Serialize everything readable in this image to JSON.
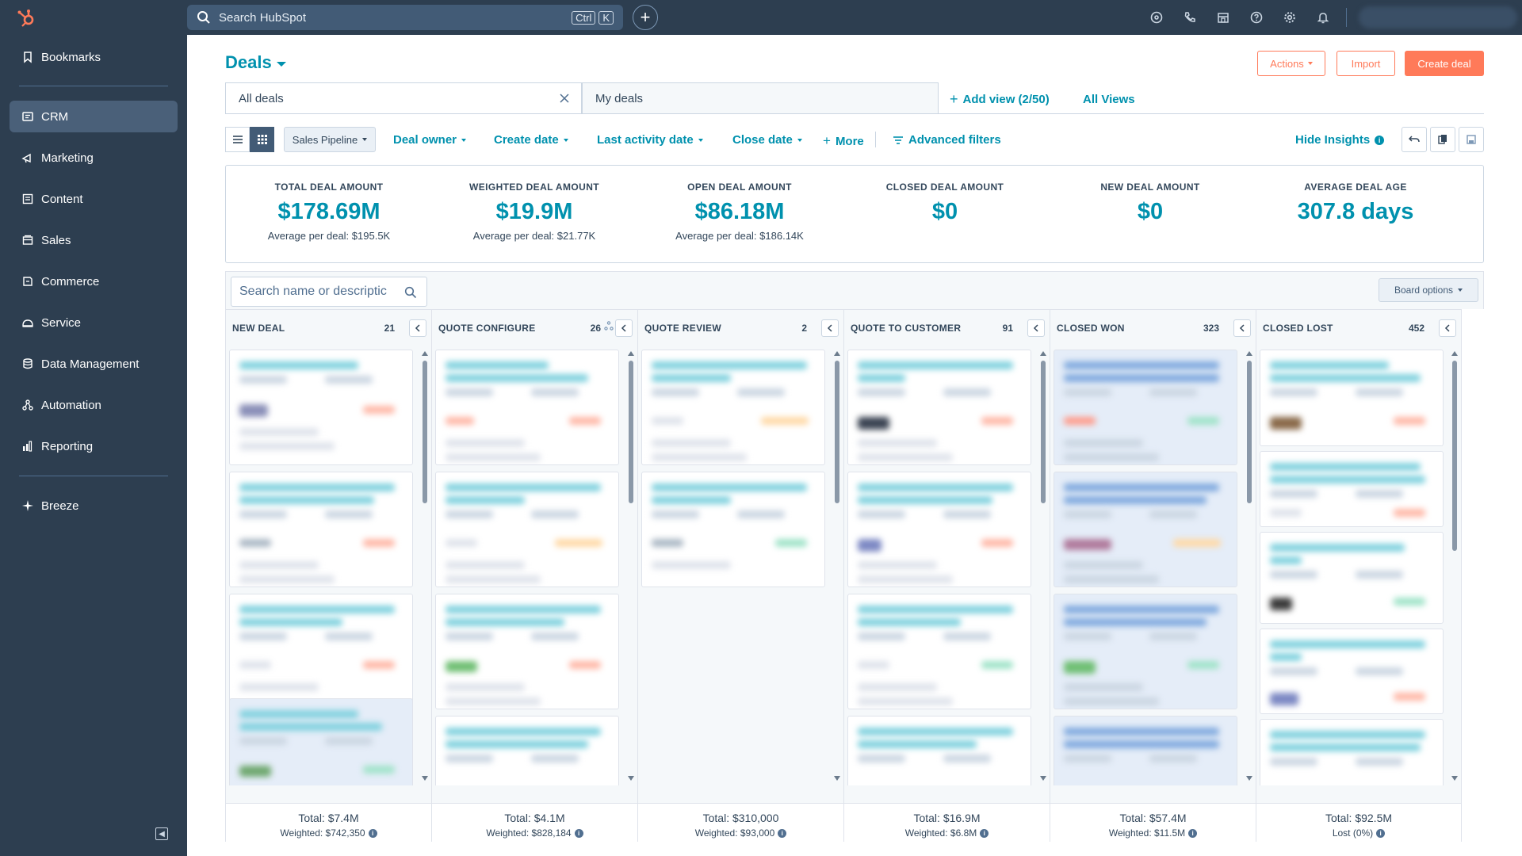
{
  "topbar": {
    "search_placeholder": "Search HubSpot",
    "shortcut_keys": [
      "Ctrl",
      "K"
    ],
    "icons": [
      "help-circle-icon",
      "phone-icon",
      "marketplace-icon",
      "question-icon",
      "settings-icon",
      "notifications-icon"
    ]
  },
  "sidebar": {
    "items": [
      {
        "label": "Bookmarks",
        "icon": "bookmark-icon"
      },
      {
        "label": "CRM",
        "icon": "crm-icon"
      },
      {
        "label": "Marketing",
        "icon": "marketing-icon"
      },
      {
        "label": "Content",
        "icon": "content-icon"
      },
      {
        "label": "Sales",
        "icon": "sales-icon"
      },
      {
        "label": "Commerce",
        "icon": "commerce-icon"
      },
      {
        "label": "Service",
        "icon": "service-icon"
      },
      {
        "label": "Data Management",
        "icon": "database-icon"
      },
      {
        "label": "Automation",
        "icon": "automation-icon"
      },
      {
        "label": "Reporting",
        "icon": "reporting-icon"
      },
      {
        "label": "Breeze",
        "icon": "breeze-icon"
      }
    ],
    "active": "CRM"
  },
  "header": {
    "title": "Deals",
    "actions_label": "Actions",
    "import_label": "Import",
    "create_label": "Create deal"
  },
  "views": {
    "tabs": [
      "All deals",
      "My deals"
    ],
    "add_view": "Add view (2/50)",
    "all_views": "All Views"
  },
  "filters": {
    "pipeline": "Sales Pipeline",
    "items": [
      "Deal owner",
      "Create date",
      "Last activity date",
      "Close date"
    ],
    "more": "More",
    "advanced": "Advanced filters",
    "hide_insights": "Hide Insights"
  },
  "insights": [
    {
      "label": "TOTAL DEAL AMOUNT",
      "value": "$178.69M",
      "sub": "Average per deal: $195.5K"
    },
    {
      "label": "WEIGHTED DEAL AMOUNT",
      "value": "$19.9M",
      "sub": "Average per deal: $21.77K"
    },
    {
      "label": "OPEN DEAL AMOUNT",
      "value": "$86.18M",
      "sub": "Average per deal: $186.14K"
    },
    {
      "label": "CLOSED DEAL AMOUNT",
      "value": "$0",
      "sub": ""
    },
    {
      "label": "NEW DEAL AMOUNT",
      "value": "$0",
      "sub": ""
    },
    {
      "label": "AVERAGE DEAL AGE",
      "value": "307.8 days",
      "sub": ""
    }
  ],
  "board": {
    "search_placeholder": "Search name or descriptic",
    "options_label": "Board options",
    "columns": [
      {
        "name": "NEW DEAL",
        "count": "21",
        "total": "Total: $7.4M",
        "weighted": "Weighted: $742,350"
      },
      {
        "name": "QUOTE CONFIGURE",
        "count": "26",
        "total": "Total: $4.1M",
        "weighted": "Weighted: $828,184"
      },
      {
        "name": "QUOTE REVIEW",
        "count": "2",
        "total": "Total: $310,000",
        "weighted": "Weighted: $93,000"
      },
      {
        "name": "QUOTE TO CUSTOMER",
        "count": "91",
        "total": "Total: $16.9M",
        "weighted": "Weighted: $6.8M"
      },
      {
        "name": "CLOSED WON",
        "count": "323",
        "total": "Total: $57.4M",
        "weighted": "Weighted: $11.5M"
      },
      {
        "name": "CLOSED LOST",
        "count": "452",
        "total": "Total: $92.5M",
        "weighted": "Lost (0%)"
      }
    ]
  },
  "colors": {
    "accent": "#0091ae",
    "brand": "#ff7a59",
    "nav_bg": "#2d3e50"
  }
}
